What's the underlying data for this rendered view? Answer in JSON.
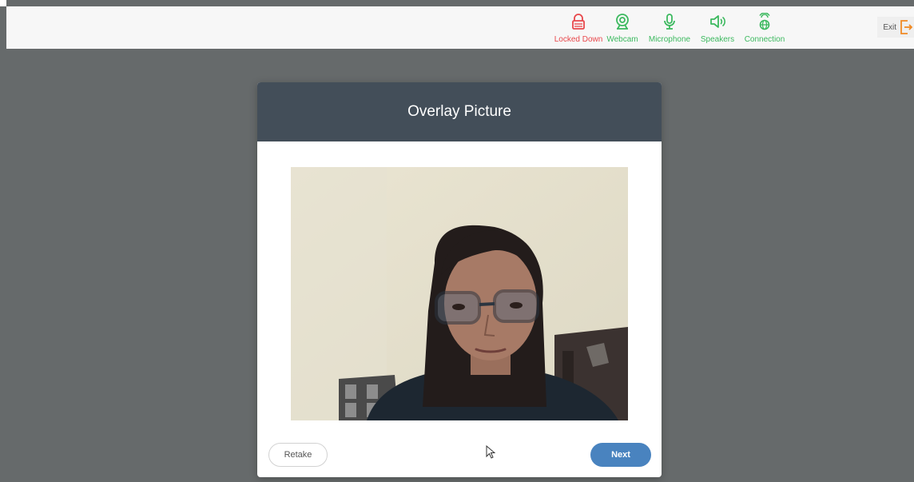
{
  "topbar": {
    "statuses": [
      {
        "label": "Locked Down",
        "icon": "lock-icon",
        "state_color": "#e8474b"
      },
      {
        "label": "Webcam",
        "icon": "webcam-icon",
        "state_color": "#3cb95f"
      },
      {
        "label": "Microphone",
        "icon": "microphone-icon",
        "state_color": "#3cb95f"
      },
      {
        "label": "Speakers",
        "icon": "speaker-icon",
        "state_color": "#3cb95f"
      },
      {
        "label": "Connection",
        "icon": "connection-icon",
        "state_color": "#3cb95f"
      }
    ],
    "exit_label": "Exit",
    "exit_icon": "exit-icon"
  },
  "modal": {
    "title": "Overlay Picture",
    "photo_icon": "webcam-snapshot",
    "retake_label": "Retake",
    "next_label": "Next"
  },
  "colors": {
    "background": "#666a6b",
    "modal_header": "#434e59",
    "primary_button": "#4983bf",
    "status_ok": "#3cb95f",
    "status_alert": "#e8474b"
  }
}
